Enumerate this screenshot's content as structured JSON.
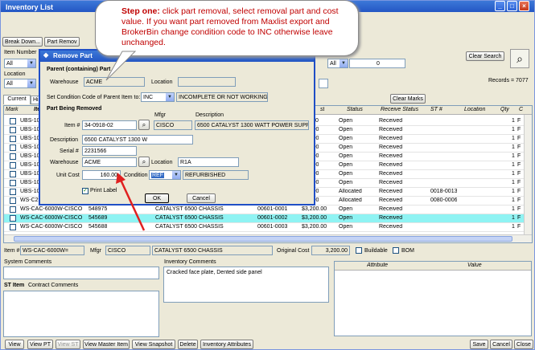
{
  "window": {
    "title": "Inventory List"
  },
  "toolbar": {
    "break_down": "Break Down...",
    "part_removal": "Part Remov"
  },
  "filters": {
    "item_number_label": "Item Number",
    "item_select": "All",
    "location_label": "Location",
    "location_select": "All",
    "all2": "All",
    "count": "0",
    "clear_search": "Clear Search",
    "records": "Records = 7077",
    "clear_marks": "Clear Marks"
  },
  "tabs": {
    "current": "Current",
    "history": "Hist"
  },
  "grid": {
    "headers": {
      "mark": "Mark",
      "item": "Ite",
      "cost": "st",
      "status": "Status",
      "receive_status": "Receive Status",
      "st_num": "ST #",
      "location": "Location",
      "qty": "Qty",
      "c": "C"
    },
    "rows": [
      {
        "item": "UBS-100",
        "cost": "115.00",
        "status": "Open",
        "receive": "Received",
        "st": "",
        "qty": "1",
        "c": "F"
      },
      {
        "item": "UBS-100",
        "cost": "400.00",
        "status": "Open",
        "receive": "Received",
        "st": "",
        "qty": "1",
        "c": "F"
      },
      {
        "item": "UBS-100",
        "cost": "160.00",
        "status": "Open",
        "receive": "Received",
        "st": "",
        "qty": "1",
        "c": "F"
      },
      {
        "item": "UBS-100",
        "cost": "400.00",
        "status": "Open",
        "receive": "Received",
        "st": "",
        "qty": "1",
        "c": "F"
      },
      {
        "item": "UBS-100",
        "cost": "400.00",
        "status": "Open",
        "receive": "Received",
        "st": "",
        "qty": "1",
        "c": "F"
      },
      {
        "item": "UBS-100",
        "cost": "400.00",
        "status": "Open",
        "receive": "Received",
        "st": "",
        "qty": "1",
        "c": "F"
      },
      {
        "item": "UBS-100",
        "cost": "400.00",
        "status": "Open",
        "receive": "Received",
        "st": "",
        "qty": "1",
        "c": "F"
      },
      {
        "item": "UBS-100",
        "cost": "400.00",
        "status": "Open",
        "receive": "Received",
        "st": "",
        "qty": "1",
        "c": "F"
      },
      {
        "item": "UBS-100",
        "cost": "400.00",
        "status": "Allocated",
        "receive": "Received",
        "st": "0018-0013",
        "qty": "1",
        "c": "F"
      },
      {
        "item": "WS-C29",
        "cost": "400.00",
        "status": "Allocated",
        "receive": "Received",
        "st": "0080-0006",
        "qty": "1",
        "c": "F"
      }
    ],
    "full_rows": [
      {
        "item": "WS-CAC-6000W-CISCO",
        "serial": "548975",
        "desc": "CATALYST 6500 CHASSIS",
        "code": "00601-0001",
        "cost": "$3,200.00",
        "status": "Open",
        "receive": "Received",
        "qty": "1",
        "c": "F"
      },
      {
        "item": "WS-CAC-6000W-CISCO",
        "serial": "545689",
        "desc": "CATALYST 6500 CHASSIS",
        "code": "00601-0002",
        "cost": "$3,200.00",
        "status": "Open",
        "receive": "Received",
        "qty": "1",
        "c": "F"
      },
      {
        "item": "WS-CAC-6000W-CISCO",
        "serial": "545688",
        "desc": "CATALYST 6500 CHASSIS",
        "code": "00601-0003",
        "cost": "$3,200.00",
        "status": "Open",
        "receive": "Received",
        "qty": "1",
        "c": "F"
      }
    ]
  },
  "detail": {
    "item_label": "Item #",
    "item_value": "WS-CAC-6000W=",
    "mfgr_label": "Mfgr",
    "mfgr_value": "CISCO",
    "desc_value": "CATALYST 6500 CHASSIS",
    "orig_cost_label": "Original Cost",
    "orig_cost_value": "3,200.00",
    "buildable": "Buildable",
    "bom": "BOM",
    "system_comments": "System Comments",
    "inventory_comments": "Inventory Comments",
    "inventory_comments_value": "Cracked face plate, Dented side panel",
    "attribute": "Attribute",
    "value": "Value",
    "st_item": "ST Item",
    "contract_comments": "Contract Comments"
  },
  "bottom": {
    "view": "View",
    "view_pt": "View PT",
    "view_st": "View ST",
    "view_master": "View Master Item",
    "view_snapshot": "View Snapshot",
    "delete": "Delete",
    "inv_attrs": "Inventory Attributes",
    "save": "Save",
    "cancel": "Cancel",
    "close": "Close"
  },
  "dialog": {
    "title": "Remove Part",
    "parent_section": "Parent (containing) Part",
    "warehouse_label": "Warehouse",
    "parent_warehouse": "ACME",
    "location_label": "Location",
    "parent_location": "",
    "cond_label": "Set Condition Code of Parent Item to:",
    "cond_select": "INC",
    "cond_desc": "INCOMPLETE OR NOT WORKING",
    "removed_section": "Part Being Removed",
    "mfgr_header": "Mfgr",
    "desc_header": "Description",
    "item_label": "Item #",
    "item_value": "34-0918-02",
    "mfgr_value": "CISCO",
    "desc_value": "6500 CATALYST 1300 WATT POWER SUPP",
    "description_label": "Description",
    "description_value": "6500 CATALYST 1300 W",
    "serial_label": "Serial #",
    "serial_value": "2231566",
    "warehouse_value": "ACME",
    "location_value": "R1A",
    "unit_cost_label": "Unit Cost",
    "unit_cost_value": "160.00",
    "condition_label": "Condition",
    "condition_value": "REF",
    "condition_desc": "REFURBISHED",
    "print_label": "Print Label",
    "ok": "OK",
    "cancel": "Cancel"
  },
  "callout": {
    "bold": "Step one:",
    "text": " click part removal, select removal part and cost value.  If you want part removed from Maxlist export and BrokerBin change condition code to INC otherwise leave unchanged."
  },
  "colors": {
    "highlight_row": "#8ff3f3",
    "callout_text": "#c00000",
    "arrow": "#e02020",
    "dialog_border": "#1f4ec6"
  }
}
